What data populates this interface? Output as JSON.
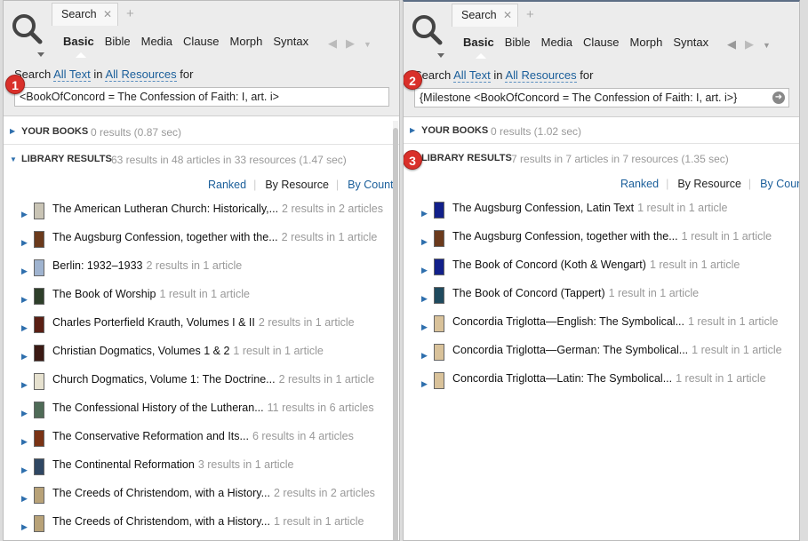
{
  "left": {
    "tab_label": "Search",
    "modes": [
      "Basic",
      "Bible",
      "Media",
      "Clause",
      "Morph",
      "Syntax"
    ],
    "scope": {
      "prefix": "Search",
      "text_scope": "All Text",
      "in": "in",
      "resource_scope": "All Resources",
      "suffix": "for"
    },
    "query": "<BookOfConcord = The Confession of Faith: I, art. i>",
    "badge": "1",
    "your_books": {
      "title": "YOUR BOOKS",
      "meta": "0 results (0.87 sec)"
    },
    "library": {
      "title": "LIBRARY RESULTS",
      "meta": "63 results in 48 articles in 33 resources (1.47 sec)"
    },
    "sorts": [
      "Ranked",
      "By Resource",
      "By Count"
    ],
    "rows": [
      {
        "name": "The American Lutheran Church: Historically,...",
        "count": "2 results in 2 articles",
        "color": "#c9c4b5"
      },
      {
        "name": "The Augsburg Confession, together with the...",
        "count": "2 results in 1 article",
        "color": "#6b3a1c"
      },
      {
        "name": "Berlin: 1932–1933",
        "count": "2 results in 1 article",
        "color": "#9fb3cf"
      },
      {
        "name": "The Book of Worship",
        "count": "1 result in 1 article",
        "color": "#2e3f2a"
      },
      {
        "name": "Charles Porterfield Krauth, Volumes I & II",
        "count": "2 results in 1 article",
        "color": "#5a1f14"
      },
      {
        "name": "Christian Dogmatics, Volumes 1 & 2",
        "count": "1 result in 1 article",
        "color": "#3b1a14"
      },
      {
        "name": "Church Dogmatics, Volume 1: The Doctrine...",
        "count": "2 results in 1 article",
        "color": "#e6e1cf"
      },
      {
        "name": "The Confessional History of the Lutheran...",
        "count": "11 results in 6 articles",
        "color": "#4f6b57"
      },
      {
        "name": "The Conservative Reformation and Its...",
        "count": "6 results in 4 articles",
        "color": "#7a3315"
      },
      {
        "name": "The Continental Reformation",
        "count": "3 results in 1 article",
        "color": "#2f4763"
      },
      {
        "name": "The Creeds of Christendom, with a History...",
        "count": "2 results in 2 articles",
        "color": "#b8a278"
      },
      {
        "name": "The Creeds of Christendom, with a History...",
        "count": "1 result in 1 article",
        "color": "#b8a278"
      }
    ]
  },
  "right": {
    "tab_label": "Search",
    "modes": [
      "Basic",
      "Bible",
      "Media",
      "Clause",
      "Morph",
      "Syntax"
    ],
    "scope": {
      "prefix": "Search",
      "text_scope": "All Text",
      "in": "in",
      "resource_scope": "All Resources",
      "suffix": "for"
    },
    "query": "{Milestone <BookOfConcord = The Confession of Faith: I, art. i>}",
    "badge_query": "2",
    "badge_library": "3",
    "your_books": {
      "title": "YOUR BOOKS",
      "meta": "0 results (1.02 sec)"
    },
    "library": {
      "title": "LIBRARY RESULTS",
      "meta": "7 results in 7 articles in 7 resources (1.35 sec)"
    },
    "sorts": [
      "Ranked",
      "By Resource",
      "By Count"
    ],
    "rows": [
      {
        "name": "The Augsburg Confession, Latin Text",
        "count": "1 result in 1 article",
        "color": "#12208a"
      },
      {
        "name": "The Augsburg Confession, together with the...",
        "count": "1 result in 1 article",
        "color": "#6b3a1c"
      },
      {
        "name": "The Book of Concord (Koth & Wengart)",
        "count": "1 result in 1 article",
        "color": "#12208a"
      },
      {
        "name": "The Book of Concord (Tappert)",
        "count": "1 result in 1 article",
        "color": "#1f4a5e"
      },
      {
        "name": "Concordia Triglotta—English: The Symbolical...",
        "count": "1 result in 1 article",
        "color": "#d9c29a"
      },
      {
        "name": "Concordia Triglotta—German: The Symbolical...",
        "count": "1 result in 1 article",
        "color": "#d9c29a"
      },
      {
        "name": "Concordia Triglotta—Latin: The Symbolical...",
        "count": "1 result in 1 article",
        "color": "#d9c29a"
      }
    ]
  }
}
